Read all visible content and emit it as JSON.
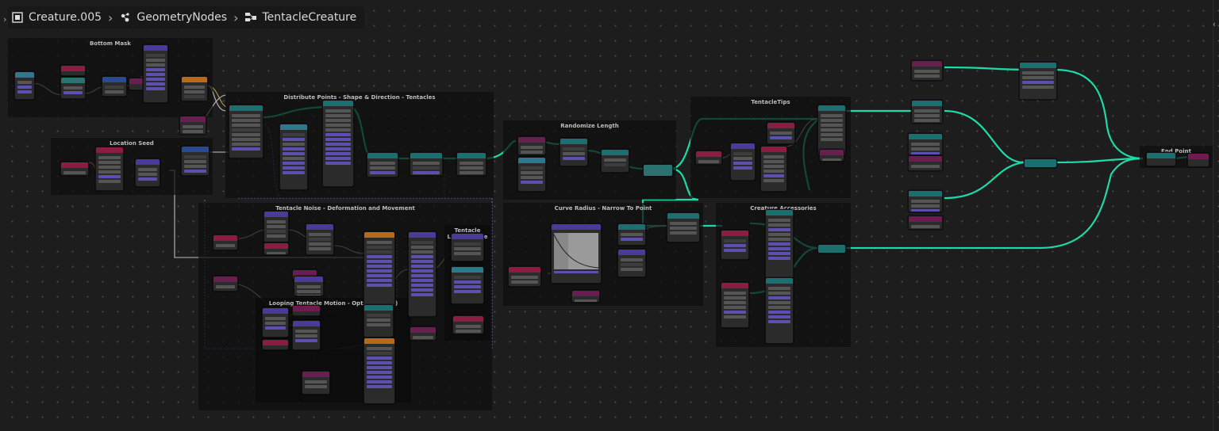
{
  "breadcrumb": {
    "object": "Creature.005",
    "modifier": "GeometryNodes",
    "node_group": "TentacleCreature"
  },
  "frames": {
    "bottom_mask": "Bottom Mask",
    "location_seed": "Location Seed",
    "distribute": "Distribute Points - Shape & Direction - Tentacles",
    "randomize_length": "Randomize Length",
    "tentacle_tips": "TentacleTips",
    "tentacle_noise": "Tentacle Noise - Deformation and Movement",
    "tentacle_length_scale": "Tentacle Length Scale",
    "looping_motion": "Looping Tentacle Motion - Optional (WIP)",
    "curve_radius": "Curve Radius - Narrow To Point",
    "creature_accessories": "Creature Accessories",
    "end_point": "End Point"
  },
  "colors": {
    "geometry_wire": "#1fd9a8",
    "float_wire": "#a8a8a8",
    "vector_wire": "#6d5fd6",
    "field_wire": "#c9c9c9"
  }
}
